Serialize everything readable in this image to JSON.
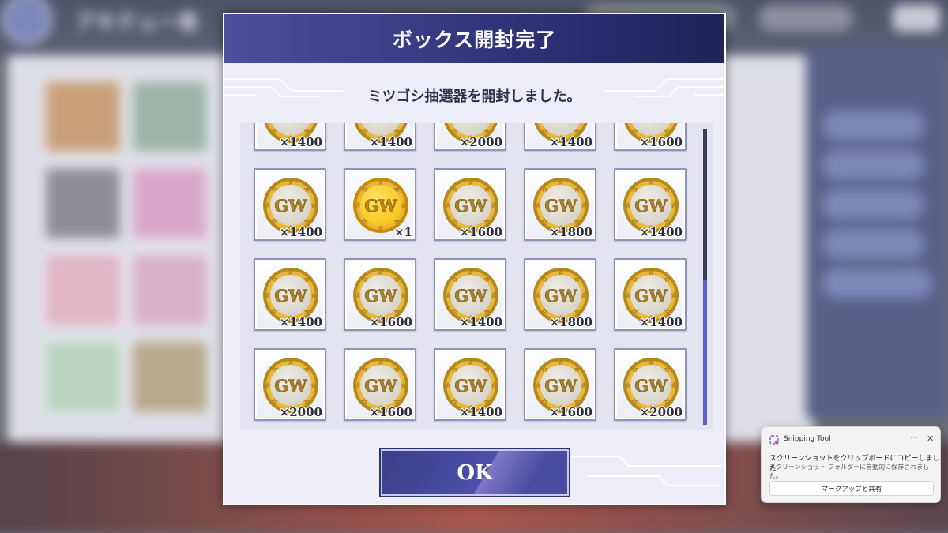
{
  "background": {
    "title": "アキテュー卷"
  },
  "dialog": {
    "title": "ボックス開封完了",
    "message": "ミツゴシ抽選器を開封しました。",
    "items": [
      {
        "qty": "×1400",
        "variant": "silver"
      },
      {
        "qty": "×1400",
        "variant": "silver"
      },
      {
        "qty": "×2000",
        "variant": "silver"
      },
      {
        "qty": "×1400",
        "variant": "silver"
      },
      {
        "qty": "×1600",
        "variant": "silver"
      },
      {
        "qty": "×1400",
        "variant": "silver"
      },
      {
        "qty": "×1",
        "variant": "gold"
      },
      {
        "qty": "×1600",
        "variant": "silver"
      },
      {
        "qty": "×1800",
        "variant": "silver"
      },
      {
        "qty": "×1400",
        "variant": "silver"
      },
      {
        "qty": "×1400",
        "variant": "silver"
      },
      {
        "qty": "×1600",
        "variant": "silver"
      },
      {
        "qty": "×1400",
        "variant": "silver"
      },
      {
        "qty": "×1800",
        "variant": "silver"
      },
      {
        "qty": "×1400",
        "variant": "silver"
      },
      {
        "qty": "×2000",
        "variant": "silver"
      },
      {
        "qty": "×1600",
        "variant": "silver"
      },
      {
        "qty": "×1400",
        "variant": "silver"
      },
      {
        "qty": "×1600",
        "variant": "silver"
      },
      {
        "qty": "×2000",
        "variant": "silver"
      }
    ],
    "coin_text": "GW",
    "ok_label": "OK",
    "colors": {
      "header_start": "#4e4e9e",
      "header_end": "#1f2357",
      "scroll_thumb": "#5b5fcf"
    }
  },
  "toast": {
    "app_name": "Snipping Tool",
    "more": "⋯",
    "close": "✕",
    "line1": "スクリーンショットをクリップボードにコピーしました",
    "line2": "スクリーンショット フォルダーに自動的に保存されました。",
    "action_label": "マークアップと共有"
  }
}
